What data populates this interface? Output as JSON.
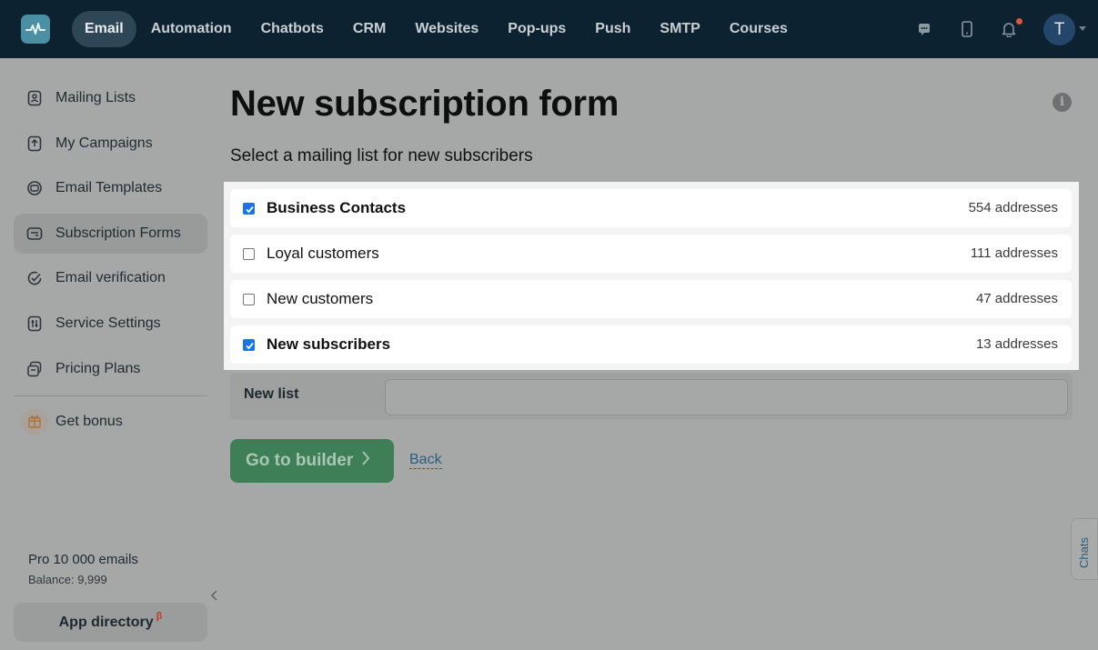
{
  "topnav": {
    "items": [
      "Email",
      "Automation",
      "Chatbots",
      "CRM",
      "Websites",
      "Pop-ups",
      "Push",
      "SMTP",
      "Courses"
    ],
    "active": "Email",
    "avatar_initial": "T"
  },
  "sidebar": {
    "items": [
      {
        "label": "Mailing Lists",
        "icon": "contacts-icon"
      },
      {
        "label": "My Campaigns",
        "icon": "campaign-icon"
      },
      {
        "label": "Email Templates",
        "icon": "template-icon"
      },
      {
        "label": "Subscription Forms",
        "icon": "form-icon"
      },
      {
        "label": "Email verification",
        "icon": "verify-icon"
      },
      {
        "label": "Service Settings",
        "icon": "settings-icon"
      },
      {
        "label": "Pricing Plans",
        "icon": "pricing-icon"
      }
    ],
    "active": "Subscription Forms",
    "bonus_label": "Get bonus",
    "plan": "Pro 10 000 emails",
    "balance": "Balance: 9,999",
    "app_directory": "App directory",
    "beta_mark": "β"
  },
  "page": {
    "title": "New subscription form",
    "subtitle": "Select a mailing list for new subscribers",
    "lists": [
      {
        "name": "Business Contacts",
        "count": "554 addresses",
        "checked": true
      },
      {
        "name": "Loyal customers",
        "count": "111 addresses",
        "checked": false
      },
      {
        "name": "New customers",
        "count": "47 addresses",
        "checked": false
      },
      {
        "name": "New subscribers",
        "count": "13 addresses",
        "checked": true
      }
    ],
    "new_list_label": "New list",
    "new_list_value": "",
    "builder_button": "Go to builder",
    "back_link": "Back",
    "chats_tab": "Chats"
  },
  "colors": {
    "topbar": "#0d2231",
    "checkbox_checked": "#1a73e8",
    "builder_button": "#3f7f57"
  }
}
